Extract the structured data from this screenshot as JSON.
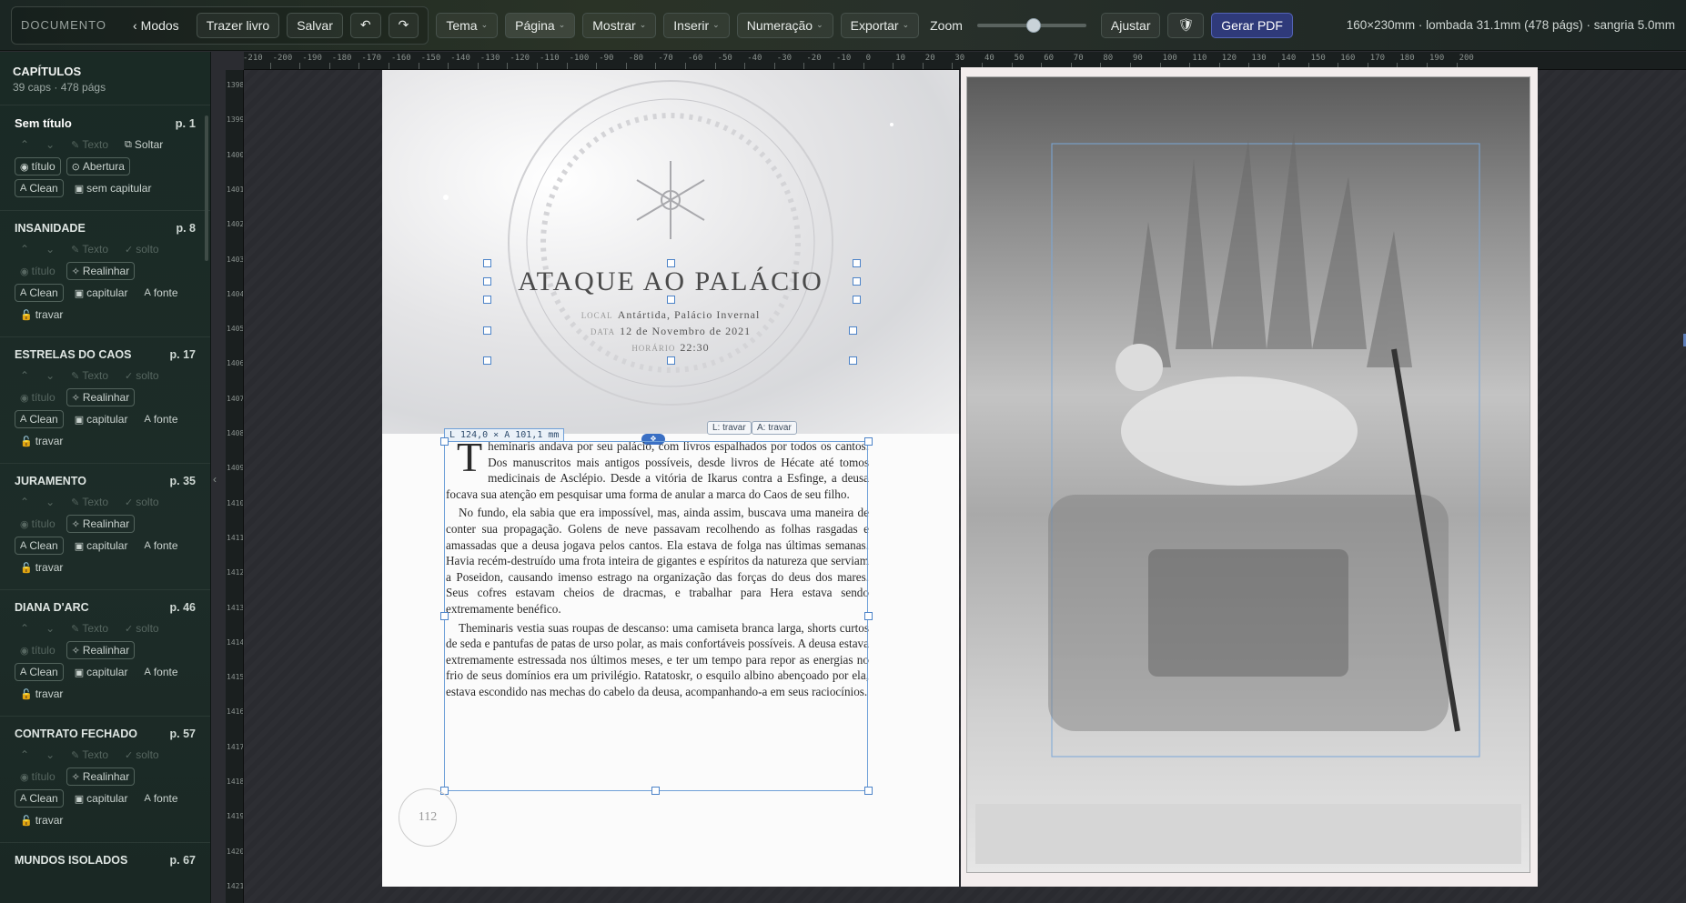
{
  "toolbar": {
    "documento": "DOCUMENTO",
    "modos": "Modos",
    "trazer": "Trazer livro",
    "salvar": "Salvar",
    "undo": "↶",
    "redo": "↷",
    "tema": "Tema",
    "pagina": "Página",
    "mostrar": "Mostrar",
    "inserir": "Inserir",
    "numeracao": "Numeração",
    "exportar": "Exportar",
    "zoom": "Zoom",
    "zoom_level": 0.52,
    "ajustar": "Ajustar",
    "gerar": "Gerar PDF",
    "specs": "160×230mm · lombada 31.1mm (478 págs) · sangria 5.0mm"
  },
  "sidebar": {
    "title": "CAPÍTULOS",
    "subtitle": "39 caps · 478 págs",
    "chapters": [
      {
        "name": "Sem título",
        "page": "p. 1",
        "texto": "Texto",
        "solto": "Soltar",
        "titulo": "título",
        "mode": "Abertura",
        "clean": "Clean",
        "cap": "sem capitular"
      },
      {
        "name": "INSANIDADE",
        "page": "p. 8",
        "texto": "Texto",
        "solto": "solto",
        "titulo": "título",
        "mode": "Realinhar",
        "clean": "Clean",
        "cap": "capitular",
        "fonte": "fonte",
        "travar": "travar"
      },
      {
        "name": "ESTRELAS DO CAOS",
        "page": "p. 17",
        "texto": "Texto",
        "solto": "solto",
        "titulo": "título",
        "mode": "Realinhar",
        "clean": "Clean",
        "cap": "capitular",
        "fonte": "fonte",
        "travar": "travar"
      },
      {
        "name": "JURAMENTO",
        "page": "p. 35",
        "texto": "Texto",
        "solto": "solto",
        "titulo": "título",
        "mode": "Realinhar",
        "clean": "Clean",
        "cap": "capitular",
        "fonte": "fonte",
        "travar": "travar"
      },
      {
        "name": "DIANA D'ARC",
        "page": "p. 46",
        "texto": "Texto",
        "solto": "solto",
        "titulo": "título",
        "mode": "Realinhar",
        "clean": "Clean",
        "cap": "capitular",
        "fonte": "fonte",
        "travar": "travar"
      },
      {
        "name": "CONTRATO FECHADO",
        "page": "p. 57",
        "texto": "Texto",
        "solto": "solto",
        "titulo": "título",
        "mode": "Realinhar",
        "clean": "Clean",
        "cap": "capitular",
        "fonte": "fonte",
        "travar": "travar"
      },
      {
        "name": "MUNDOS ISOLADOS",
        "page": "p. 67"
      }
    ]
  },
  "ruler": {
    "h": [
      "-210",
      "-200",
      "-190",
      "-180",
      "-170",
      "-160",
      "-150",
      "-140",
      "-130",
      "-120",
      "-110",
      "-100",
      "-90",
      "-80",
      "-70",
      "-60",
      "-50",
      "-40",
      "-30",
      "-20",
      "-10",
      "0",
      "10",
      "20",
      "30",
      "40",
      "50",
      "60",
      "70",
      "80",
      "90",
      "100",
      "110",
      "120",
      "130",
      "140",
      "150",
      "160",
      "170",
      "180",
      "190",
      "200"
    ],
    "v": [
      "1398",
      "1399",
      "1400",
      "1401",
      "1402",
      "1403",
      "1404",
      "1405",
      "1406",
      "1407",
      "1408",
      "1409",
      "1410",
      "1411",
      "1412",
      "1413",
      "1414",
      "1415",
      "1416",
      "1417",
      "1418",
      "1419",
      "1420",
      "1421"
    ]
  },
  "page": {
    "title": "ATAQUE AO PALÁCIO",
    "local_k": "local",
    "local_v": "Antártida, Palácio Invernal",
    "data_k": "data",
    "data_v": "12 de Novembro de 2021",
    "hora_k": "horário",
    "hora_v": "22:30",
    "size_label": "L 124,0 × A 101,1 mm",
    "lock_l": "L: travar",
    "lock_a": "A: travar",
    "dropcap": "T",
    "p1": "heminaris andava por seu palácio, com livros espalhados por todos os cantos. Dos manuscritos mais antigos possíveis, desde livros de Hécate até tomos medicinais de Asclépio. Desde a vitória de Ikarus contra a Esfinge, a deusa focava sua atenção em pesquisar uma forma de anular a marca do Caos de seu filho.",
    "p2": "No fundo, ela sabia que era impossível, mas, ainda assim, buscava uma maneira de conter sua propagação. Golens de neve passavam recolhendo as folhas rasgadas e amassadas que a deusa jogava pelos cantos. Ela estava de folga nas últimas semanas. Havia recém-destruído uma frota inteira de gigantes e espíritos da natureza que serviam a Poseidon, causando imenso estrago na organização das forças do deus dos mares. Seus cofres estavam cheios de dracmas, e trabalhar para Hera estava sendo extremamente benéfico.",
    "p3": "Theminaris vestia suas roupas de descanso: uma camiseta branca larga, shorts curtos de seda e pantufas de patas de urso polar, as mais confortáveis possíveis. A deusa estava extremamente estressada nos últimos meses, e ter um tempo para repor as energias no frio de seus domínios era um privilégio. Ratatoskr, o esquilo albino abençoado por ela, estava escondido nas mechas do cabelo da deusa, acompanhando-a em seus raciocínios.",
    "page_number": "112"
  },
  "icons": {
    "chevron": "chevron-left-icon",
    "pen": "pen-icon",
    "eye": "eye-icon",
    "clean": "clean-icon",
    "lock": "lock-icon",
    "shield": "shield-check-icon"
  }
}
